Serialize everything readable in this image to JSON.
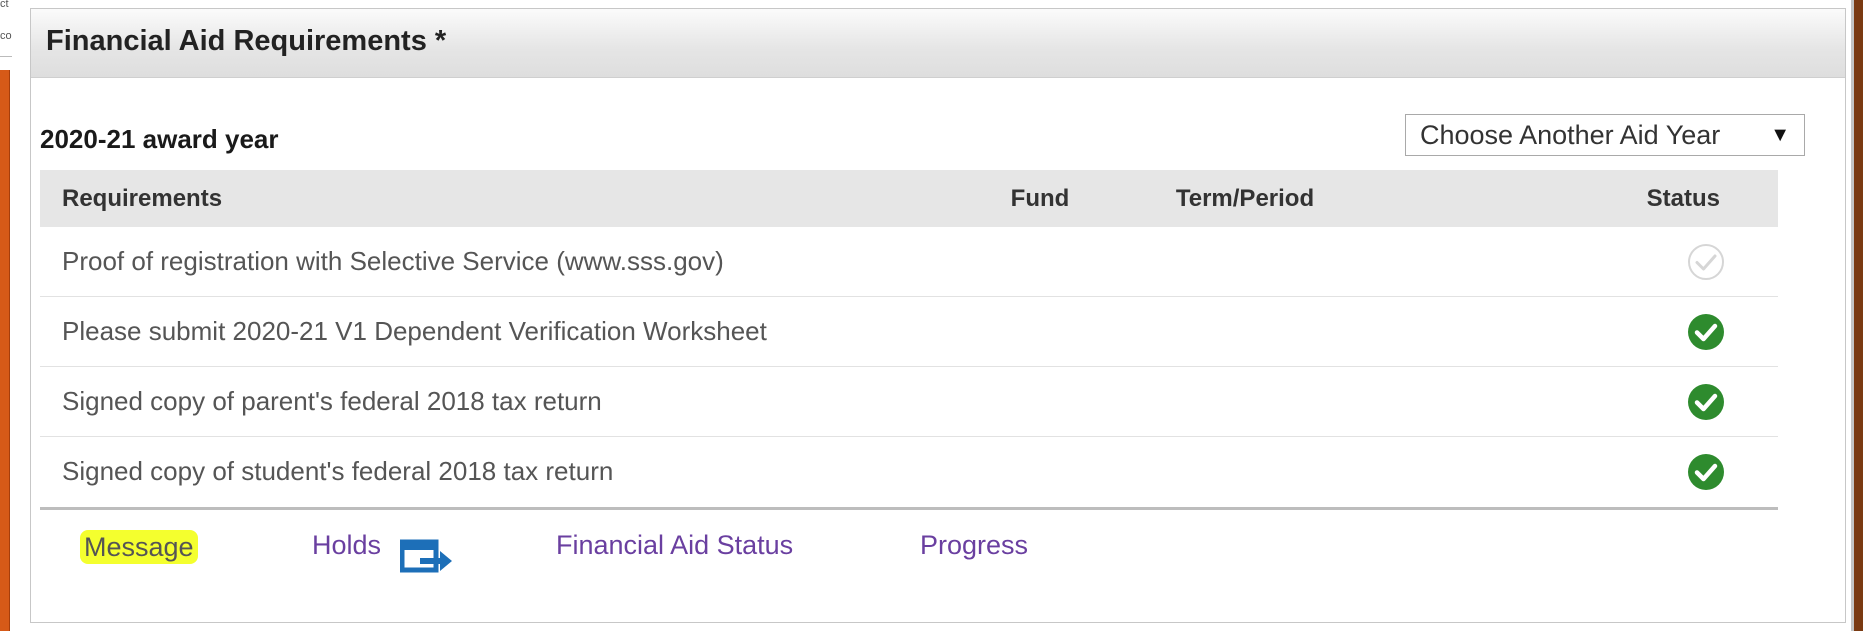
{
  "left_fragments": [
    "ct",
    "co"
  ],
  "panel": {
    "title": "Financial Aid Requirements *"
  },
  "award_year": {
    "label": "2020-21 award year",
    "select_value": "Choose Another Aid Year",
    "select_arrow": "▼"
  },
  "table": {
    "headers": {
      "requirements": "Requirements",
      "fund": "Fund",
      "term": "Term/Period",
      "status": "Status"
    },
    "rows": [
      {
        "requirement": "Proof of registration with Selective Service (www.sss.gov)",
        "fund": "",
        "term": "",
        "status": "pending",
        "status_icon": "check-outline-icon"
      },
      {
        "requirement": "Please submit 2020-21 V1 Dependent Verification Worksheet",
        "fund": "",
        "term": "",
        "status": "complete",
        "status_icon": "check-circle-icon"
      },
      {
        "requirement": "Signed copy of parent's federal 2018 tax return",
        "fund": "",
        "term": "",
        "status": "complete",
        "status_icon": "check-circle-icon"
      },
      {
        "requirement": "Signed copy of student's federal 2018 tax return",
        "fund": "",
        "term": "",
        "status": "complete",
        "status_icon": "check-circle-icon"
      }
    ]
  },
  "footer_links": {
    "message": "Message",
    "holds": "Holds",
    "holds_icon": "external-link-icon",
    "financial_aid_status": "Financial Aid Status",
    "progress": "Progress"
  },
  "colors": {
    "link": "#6a3fa0",
    "complete_green": "#2e8b2e",
    "pending_grey": "#d6d6d6",
    "highlight_yellow": "#f4ff2e",
    "holds_icon_blue": "#1d6fb8",
    "left_orange_bar": "#d65a18"
  }
}
